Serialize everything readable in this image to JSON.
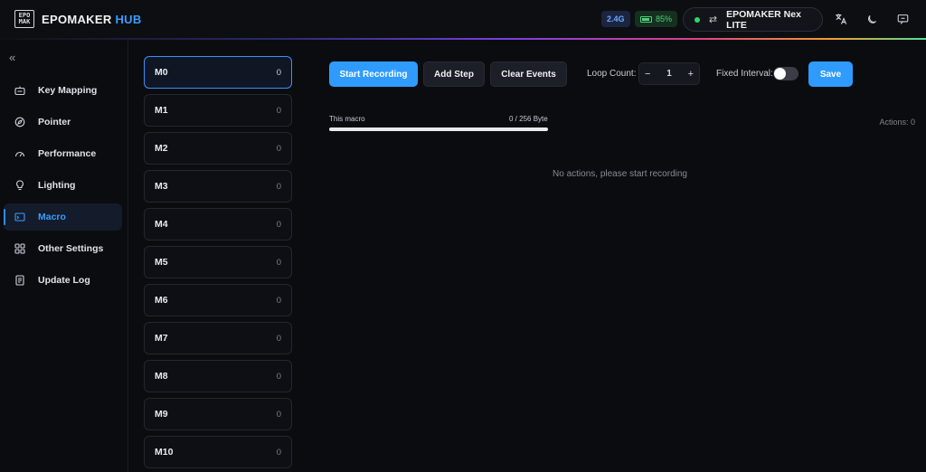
{
  "header": {
    "logo_mark": "EPO MAK",
    "brand": "EPOMAKER",
    "brand_accent": "HUB",
    "connection": "2.4G",
    "battery": "85%",
    "device_name": "EPOMAKER Nex LITE"
  },
  "sidebar": {
    "items": [
      {
        "label": "Key Mapping",
        "icon": "keyboard-icon"
      },
      {
        "label": "Pointer",
        "icon": "compass-icon"
      },
      {
        "label": "Performance",
        "icon": "gauge-icon"
      },
      {
        "label": "Lighting",
        "icon": "bulb-icon"
      },
      {
        "label": "Macro",
        "icon": "macro-icon",
        "active": true
      },
      {
        "label": "Other Settings",
        "icon": "grid-icon"
      },
      {
        "label": "Update Log",
        "icon": "document-icon"
      }
    ]
  },
  "macros": [
    {
      "name": "M0",
      "count": "0"
    },
    {
      "name": "M1",
      "count": "0"
    },
    {
      "name": "M2",
      "count": "0"
    },
    {
      "name": "M3",
      "count": "0"
    },
    {
      "name": "M4",
      "count": "0"
    },
    {
      "name": "M5",
      "count": "0"
    },
    {
      "name": "M6",
      "count": "0"
    },
    {
      "name": "M7",
      "count": "0"
    },
    {
      "name": "M8",
      "count": "0"
    },
    {
      "name": "M9",
      "count": "0"
    },
    {
      "name": "M10",
      "count": "0"
    }
  ],
  "toolbar": {
    "start_recording": "Start Recording",
    "add_step": "Add Step",
    "clear_events": "Clear Events",
    "loop_count_label": "Loop Count:",
    "loop_count_value": "1",
    "minus": "−",
    "plus": "+",
    "fixed_interval_label": "Fixed Interval:",
    "save": "Save"
  },
  "editor": {
    "macro_label": "This macro",
    "size": "0 / 256 Byte",
    "progress_fraction": 0,
    "actions": "Actions: 0",
    "empty_message": "No actions, please start recording"
  },
  "colors": {
    "accent": "#2f9bff",
    "online": "#2fd66a",
    "battery": "#4fd07a"
  }
}
